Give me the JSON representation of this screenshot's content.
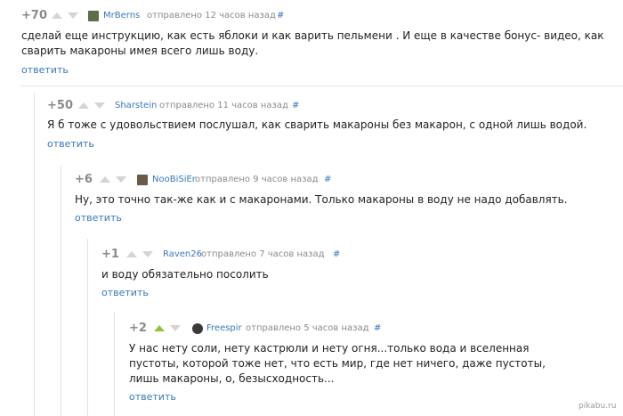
{
  "comments": [
    {
      "score": "+70",
      "author": "MrBerns",
      "sent": "отправлено 12 часов назад",
      "hash": "#",
      "text": "сделай еще инструкцию, как есть яблоки и как варить пельмени . И еще в качестве бонус- видео, как сварить макароны имея всего лишь воду.",
      "reply": "ответить",
      "upvoted": false,
      "avatar_color": "#5b6e4a"
    },
    {
      "score": "+50",
      "author": "Sharstein",
      "sent": "отправлено 11 часов назад",
      "hash": "#",
      "text": "Я б тоже с удовольствием послушал, как сварить макароны без макарон, с одной лишь водой.",
      "reply": "ответить",
      "upvoted": false,
      "avatar_color": ""
    },
    {
      "score": "+6",
      "author": "NooBiSiEr",
      "sent": "отправлено 9 часов назад",
      "hash": "#",
      "text": "Ну, это точно так-же как и с макаронами. Только макароны в воду не надо добавлять.",
      "reply": "ответить",
      "upvoted": false,
      "avatar_color": "#6a5a4a"
    },
    {
      "score": "+1",
      "author": "Raven26",
      "sent": "отправлено 7 часов назад",
      "hash": "#",
      "text": "и воду обязательно посолить",
      "reply": "ответить",
      "upvoted": false,
      "avatar_color": ""
    },
    {
      "score": "+2",
      "author": "Freespir",
      "sent": "отправлено 5 часов назад",
      "hash": "#",
      "text": "У нас нету соли, нету кастрюли и нету огня...только вода и вселенная пустоты, которой тоже нет, что есть мир, где нет ничего, даже пустоты, лишь макароны, о, безысходность...",
      "reply": "ответить",
      "upvoted": true,
      "avatar_color": "#3a3a3a"
    }
  ],
  "watermark": "pikabu.ru",
  "colors": {
    "link": "#3a78b8",
    "muted": "#8a8a8a",
    "upvote_active": "#8fc33d",
    "arrow": "#d4d4d4"
  }
}
